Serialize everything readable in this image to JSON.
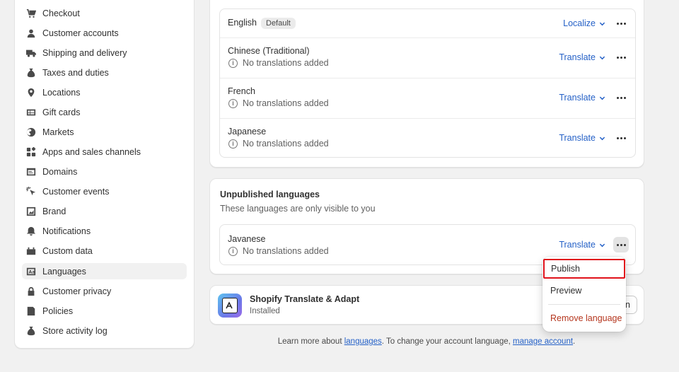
{
  "sidebar": {
    "items": [
      {
        "label": "Checkout",
        "icon": "cart-icon"
      },
      {
        "label": "Customer accounts",
        "icon": "person-icon"
      },
      {
        "label": "Shipping and delivery",
        "icon": "truck-icon"
      },
      {
        "label": "Taxes and duties",
        "icon": "money-bag-icon"
      },
      {
        "label": "Locations",
        "icon": "location-pin-icon"
      },
      {
        "label": "Gift cards",
        "icon": "gift-card-icon"
      },
      {
        "label": "Markets",
        "icon": "globe-icon"
      },
      {
        "label": "Apps and sales channels",
        "icon": "apps-icon"
      },
      {
        "label": "Domains",
        "icon": "domain-icon"
      },
      {
        "label": "Customer events",
        "icon": "cursor-click-icon"
      },
      {
        "label": "Brand",
        "icon": "brand-icon"
      },
      {
        "label": "Notifications",
        "icon": "bell-icon"
      },
      {
        "label": "Custom data",
        "icon": "database-icon"
      },
      {
        "label": "Languages",
        "icon": "language-icon",
        "active": true
      },
      {
        "label": "Customer privacy",
        "icon": "lock-icon"
      },
      {
        "label": "Policies",
        "icon": "policy-icon"
      },
      {
        "label": "Store activity log",
        "icon": "activity-log-icon"
      }
    ]
  },
  "published": {
    "languages": [
      {
        "name": "English",
        "badge": "Default",
        "action": "Localize",
        "status": ""
      },
      {
        "name": "Chinese (Traditional)",
        "action": "Translate",
        "status": "No translations added"
      },
      {
        "name": "French",
        "action": "Translate",
        "status": "No translations added"
      },
      {
        "name": "Japanese",
        "action": "Translate",
        "status": "No translations added"
      }
    ]
  },
  "unpublished": {
    "title": "Unpublished languages",
    "subtitle": "These languages are only visible to you",
    "languages": [
      {
        "name": "Javanese",
        "action": "Translate",
        "status": "No translations added"
      }
    ]
  },
  "app": {
    "title": "Shopify Translate & Adapt",
    "status": "Installed",
    "button_partial": "n"
  },
  "menu": {
    "publish": "Publish",
    "preview": "Preview",
    "remove": "Remove language"
  },
  "footer": {
    "prefix": "Learn more about ",
    "link1": "languages",
    "middle": ". To change your account language, ",
    "link2": "manage account",
    "suffix": "."
  },
  "colors": {
    "link": "#2561c7",
    "danger": "#b5361e",
    "highlight_outline": "#e0121b"
  }
}
